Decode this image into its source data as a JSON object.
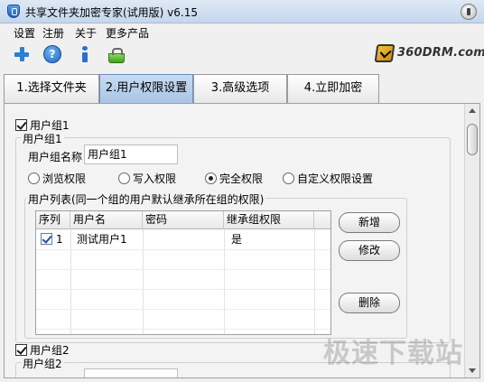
{
  "window": {
    "title": "共享文件夹加密专家(试用版) v6.15"
  },
  "menu": [
    "设置",
    "注册",
    "关于",
    "更多产品"
  ],
  "toolbar_icons": [
    "add-icon",
    "help-icon",
    "info-icon",
    "cart-icon"
  ],
  "brand": {
    "text": "360DRM.com"
  },
  "tabs": [
    {
      "label": "1.选择文件夹",
      "active": false
    },
    {
      "label": "2.用户权限设置",
      "active": true
    },
    {
      "label": "3.高级选项",
      "active": false
    },
    {
      "label": "4.立即加密",
      "active": false
    }
  ],
  "group1": {
    "checkbox_label": "用户组1",
    "checked": true,
    "box_title": "用户组1",
    "name_label": "用户组名称",
    "name_value": "用户组1",
    "permissions": [
      {
        "label": "浏览权限",
        "selected": false
      },
      {
        "label": "写入权限",
        "selected": false
      },
      {
        "label": "完全权限",
        "selected": true
      },
      {
        "label": "自定义权限设置",
        "selected": false
      }
    ],
    "user_list_title": "用户列表(同一个组的用户默认继承所在组的权限)",
    "columns": [
      "序列",
      "用户名",
      "密码",
      "继承组权限"
    ],
    "rows": [
      {
        "checked": true,
        "seq": "1",
        "username": "测试用户1",
        "password": "",
        "inherit": "是"
      }
    ],
    "buttons": {
      "add": "新增",
      "edit": "修改",
      "delete": "删除"
    }
  },
  "group2": {
    "checkbox_label": "用户组2",
    "checked": true,
    "box_title": "用户组2"
  },
  "watermark": "极速下载站"
}
